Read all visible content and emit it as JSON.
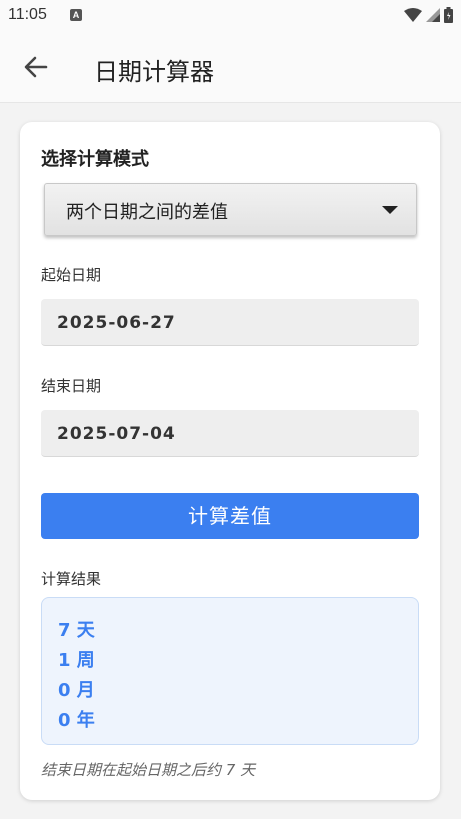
{
  "status_bar": {
    "time": "11:05",
    "notification_icon": "a-letter-icon",
    "icons": [
      "wifi-icon",
      "signal-icon",
      "battery-icon"
    ]
  },
  "app_bar": {
    "title": "日期计算器",
    "back_icon": "arrow-left-icon"
  },
  "card": {
    "mode_label": "选择计算模式",
    "mode_selected": "两个日期之间的差值",
    "start_label": "起始日期",
    "start_value": "2025-06-27",
    "end_label": "结束日期",
    "end_value": "2025-07-04",
    "calc_button": "计算差值",
    "result_label": "计算结果",
    "result_lines": [
      "7 天",
      "1 周",
      "0 月",
      "0 年"
    ],
    "note": "结束日期在起始日期之后约 7 天"
  },
  "colors": {
    "accent": "#3b7ff0",
    "result_bg": "#eef4fd"
  }
}
